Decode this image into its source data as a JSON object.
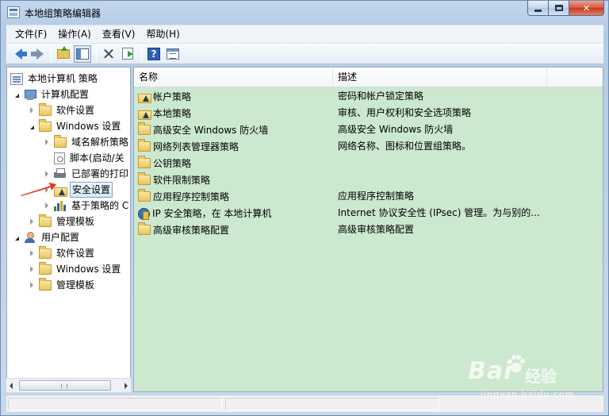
{
  "window": {
    "title": "本地组策略编辑器",
    "close_glyph": "✕"
  },
  "menu": [
    "文件(F)",
    "操作(A)",
    "查看(V)",
    "帮助(H)"
  ],
  "toolbar": {
    "help_glyph": "?",
    "delete_glyph": "✕"
  },
  "tree": [
    {
      "label": "本地计算机 策略",
      "icon": "policy-root-icon",
      "indent": 0,
      "expander": "none"
    },
    {
      "label": "计算机配置",
      "icon": "computer-icon",
      "indent": 1,
      "expander": "open"
    },
    {
      "label": "软件设置",
      "icon": "folder-icon",
      "indent": 2,
      "expander": "closed"
    },
    {
      "label": "Windows 设置",
      "icon": "folder-icon",
      "indent": 2,
      "expander": "open"
    },
    {
      "label": "域名解析策略",
      "icon": "folder-icon",
      "indent": 3,
      "expander": "closed"
    },
    {
      "label": "脚本(启动/关",
      "icon": "script-icon",
      "indent": 3,
      "expander": "none"
    },
    {
      "label": "已部署的打印",
      "icon": "printer-icon",
      "indent": 3,
      "expander": "closed"
    },
    {
      "label": "安全设置",
      "icon": "security-icon",
      "indent": 3,
      "expander": "closed",
      "selected": true
    },
    {
      "label": "基于策略的 C",
      "icon": "chart-icon",
      "indent": 3,
      "expander": "closed"
    },
    {
      "label": "管理模板",
      "icon": "folder-icon",
      "indent": 2,
      "expander": "closed"
    },
    {
      "label": "用户配置",
      "icon": "user-icon",
      "indent": 1,
      "expander": "open"
    },
    {
      "label": "软件设置",
      "icon": "folder-icon",
      "indent": 2,
      "expander": "closed"
    },
    {
      "label": "Windows 设置",
      "icon": "folder-icon",
      "indent": 2,
      "expander": "closed"
    },
    {
      "label": "管理模板",
      "icon": "folder-icon",
      "indent": 2,
      "expander": "closed"
    }
  ],
  "list": {
    "columns": [
      "名称",
      "描述"
    ],
    "rows": [
      {
        "name": "帐户策略",
        "desc": "密码和帐户锁定策略",
        "icon": "security-icon"
      },
      {
        "name": "本地策略",
        "desc": "审核、用户权利和安全选项策略",
        "icon": "security-icon"
      },
      {
        "name": "高级安全 Windows 防火墙",
        "desc": "高级安全 Windows 防火墙",
        "icon": "folder-icon"
      },
      {
        "name": "网络列表管理器策略",
        "desc": "网络名称、图标和位置组策略。",
        "icon": "folder-icon"
      },
      {
        "name": "公钥策略",
        "desc": "",
        "icon": "folder-icon"
      },
      {
        "name": "软件限制策略",
        "desc": "",
        "icon": "folder-icon"
      },
      {
        "name": "应用程序控制策略",
        "desc": "应用程序控制策略",
        "icon": "folder-icon"
      },
      {
        "name": "IP 安全策略，在 本地计算机",
        "desc": "Internet 协议安全性 (IPsec) 管理。为与别的...",
        "icon": "ipsec-icon"
      },
      {
        "name": "高级审核策略配置",
        "desc": "高级审核策略配置",
        "icon": "folder-icon"
      }
    ]
  },
  "watermark": {
    "brand": "Bai",
    "brand_suffix": "经验",
    "url": "jingyan.baidu.com"
  },
  "colors": {
    "list_background": "#cce8cf",
    "selection_border": "#7da2ce",
    "annotation_arrow": "#e8321e"
  }
}
